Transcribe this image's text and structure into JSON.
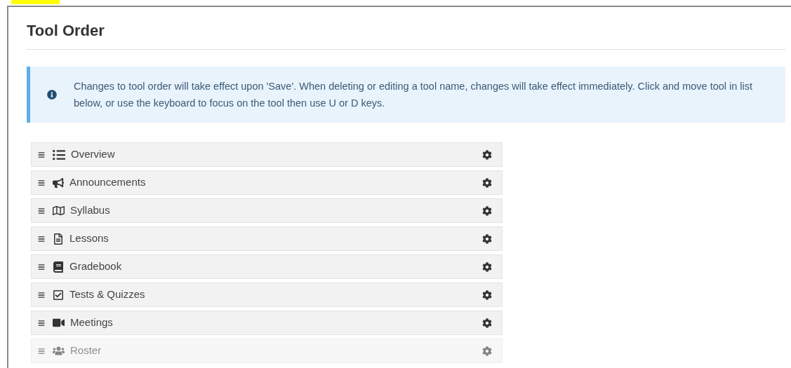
{
  "title": "Tool Order",
  "notice": "Changes to tool order will take effect upon 'Save'. When deleting or editing a tool name, changes will take effect immediately. Click and move tool in list below, or use the keyboard to focus on the tool then use U or D keys.",
  "tools": [
    {
      "label": "Overview",
      "faded": false
    },
    {
      "label": "Announcements",
      "faded": false
    },
    {
      "label": "Syllabus",
      "faded": false
    },
    {
      "label": "Lessons",
      "faded": false
    },
    {
      "label": "Gradebook",
      "faded": false
    },
    {
      "label": "Tests & Quizzes",
      "faded": false
    },
    {
      "label": "Meetings",
      "faded": false
    },
    {
      "label": "Roster",
      "faded": true
    }
  ]
}
